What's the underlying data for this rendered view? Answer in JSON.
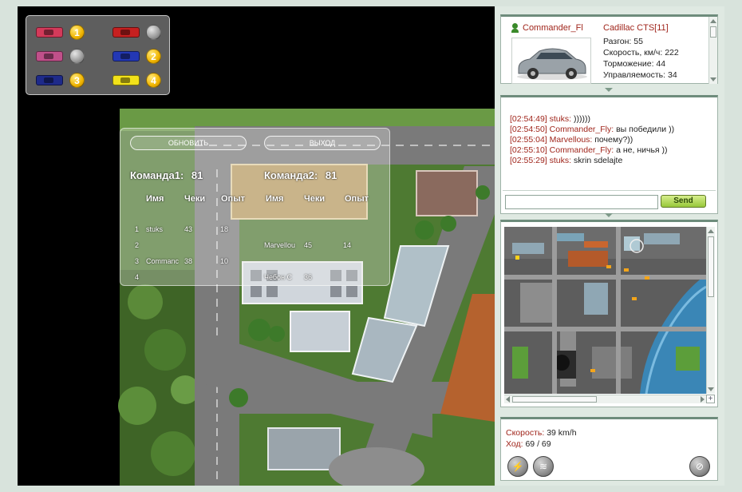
{
  "legend": [
    {
      "car_color": "#d43a5a",
      "position": "1",
      "badge": "gold"
    },
    {
      "car_color": "#c62020",
      "position": "",
      "badge": "gray"
    },
    {
      "car_color": "#c0508a",
      "position": "",
      "badge": "gray"
    },
    {
      "car_color": "#2338b5",
      "position": "2",
      "badge": "gold"
    },
    {
      "car_color": "#1e2a8a",
      "position": "3",
      "badge": "gold"
    },
    {
      "car_color": "#f2e21a",
      "position": "4",
      "badge": "gold"
    }
  ],
  "scoreboard": {
    "refresh_label": "ОБНОВИТЬ",
    "exit_label": "ВЫХОД",
    "team1": {
      "title": "Команда1:",
      "score": "81",
      "headers": [
        "Имя",
        "Чеки",
        "Опыт"
      ],
      "rows": [
        {
          "num": "1",
          "name": "stuks",
          "checks": "43",
          "exp": "18"
        },
        {
          "num": "2",
          "name": "",
          "checks": "",
          "exp": ""
        },
        {
          "num": "3",
          "name": "Commanc",
          "checks": "38",
          "exp": "10"
        },
        {
          "num": "4",
          "name": "",
          "checks": "",
          "exp": ""
        }
      ]
    },
    "team2": {
      "title": "Команда2:",
      "score": "81",
      "headers": [
        "Имя",
        "Чеки",
        "Опыт"
      ],
      "rows": [
        {
          "name": "",
          "checks": "",
          "exp": ""
        },
        {
          "name": "Marvellou",
          "checks": "45",
          "exp": "14"
        },
        {
          "name": "Чебон С",
          "checks": "36",
          "exp": ""
        }
      ]
    }
  },
  "player": {
    "name": "Commander_Fl",
    "car_model": "Cadillac CTS[11]",
    "stats": [
      "Разгон: 55",
      "Скорость, км/ч: 222",
      "Торможение: 44",
      "Управляемость: 34"
    ]
  },
  "chat": {
    "messages": [
      {
        "time": "[02:54:49]",
        "name": "stuks:",
        "text": "))))))"
      },
      {
        "time": "[02:54:50]",
        "name": "Commander_Fly:",
        "text": "вы победили ))"
      },
      {
        "time": "[02:55:04]",
        "name": "Marvellous:",
        "text": "почему?))"
      },
      {
        "time": "[02:55:10]",
        "name": "Commander_Fly:",
        "text": "а не, ничья ))"
      },
      {
        "time": "[02:55:29]",
        "name": "stuks:",
        "text": "skrin sdelajte"
      }
    ],
    "input_value": "",
    "send_label": "Send"
  },
  "status": {
    "speed_label": "Скорость:",
    "speed_value": "39 km/h",
    "moves_label": "Ход:",
    "moves_value": "69 / 69"
  }
}
